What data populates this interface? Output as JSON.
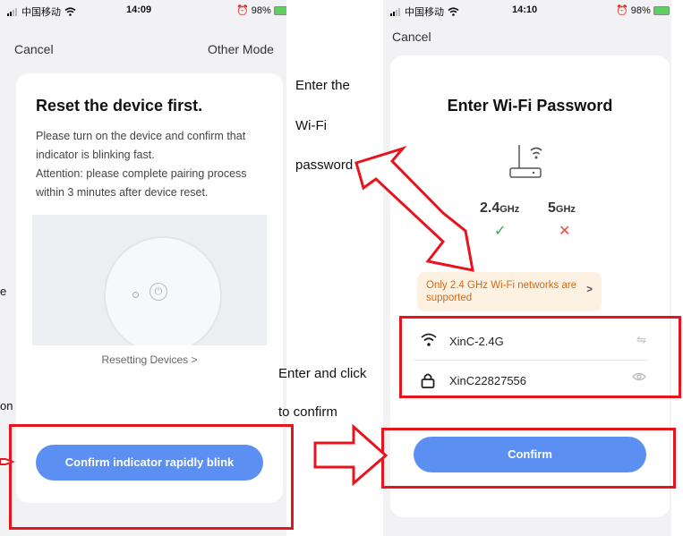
{
  "left_screen": {
    "status": {
      "carrier": "中国移动",
      "time": "14:09",
      "battery": "98%"
    },
    "nav": {
      "cancel": "Cancel",
      "other_mode": "Other Mode"
    },
    "card": {
      "title": "Reset the device first.",
      "desc1": "Please turn on the device and confirm that indicator is blinking fast.",
      "desc2": "Attention: please complete pairing process within 3 minutes after device reset.",
      "link": "Resetting Devices >",
      "button": "Confirm indicator rapidly blink"
    }
  },
  "right_screen": {
    "status": {
      "carrier": "中国移动",
      "time": "14:10",
      "battery": "98%"
    },
    "nav": {
      "cancel": "Cancel"
    },
    "card": {
      "title": "Enter Wi-Fi Password",
      "band_24": "2.4",
      "band_5": "5",
      "band_unit": "GHz",
      "notice": "Only 2.4 GHz Wi-Fi networks are supported",
      "notice_chevron": ">",
      "ssid": "XinC-2.4G",
      "password": "XinC22827556",
      "button": "Confirm"
    }
  },
  "annotations": {
    "enter_the": "Enter the",
    "wifi": "Wi-Fi",
    "password": "password",
    "enter_click": "Enter and click",
    "to_confirm": "to confirm",
    "edge_e": "e",
    "edge_on": "on"
  },
  "colors": {
    "accent": "#5b8ff2",
    "highlight": "#e8141d",
    "ok": "#22b14c",
    "fail": "#e74c3c"
  }
}
